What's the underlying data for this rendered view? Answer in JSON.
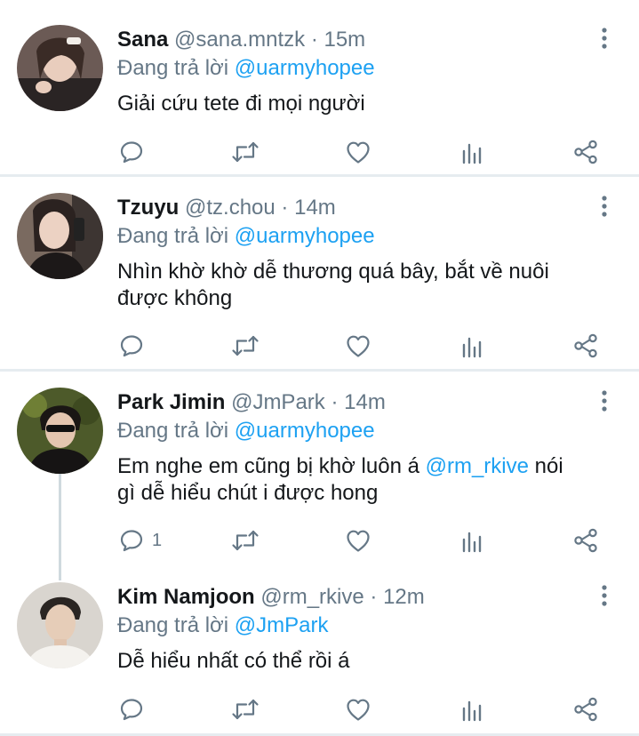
{
  "tweets": [
    {
      "name": "Sana",
      "handle": "@sana.mntzk",
      "separator": "·",
      "time": "15m",
      "reply_prefix": "Đang trả lời",
      "reply_to": "@uarmyhopee",
      "text": "Giải cứu tete đi mọi người",
      "reply_count": ""
    },
    {
      "name": "Tzuyu",
      "handle": "@tz.chou",
      "separator": "·",
      "time": "14m",
      "reply_prefix": "Đang trả lời",
      "reply_to": "@uarmyhopee",
      "text_line1": "Nhìn khờ khờ dễ thương quá bây, bắt về nuôi",
      "text_line2": "được không",
      "reply_count": ""
    },
    {
      "name": "Park Jimin",
      "handle": "@JmPark",
      "separator": "·",
      "time": "14m",
      "reply_prefix": "Đang trả lời",
      "reply_to": "@uarmyhopee",
      "text_before": "Em nghe em cũng bị khờ luôn á ",
      "text_mention": "@rm_rkive",
      "text_after": " nói",
      "text_line2": "gì dễ hiểu chút i được hong",
      "reply_count": "1"
    },
    {
      "name": "Kim Namjoon",
      "handle": "@rm_rkive",
      "separator": "·",
      "time": "12m",
      "reply_prefix": "Đang trả lời",
      "reply_to": "@JmPark",
      "text": "Dễ hiểu nhất có thể rồi á",
      "reply_count": ""
    }
  ],
  "icons": {
    "reply": "reply-icon",
    "retweet": "retweet-icon",
    "like": "heart-icon",
    "analytics": "analytics-icon",
    "share": "share-icon",
    "more": "more-vertical-icon"
  },
  "colors": {
    "link": "#1da1f2",
    "secondary_text": "#657786",
    "divider": "#e6ecf0"
  }
}
